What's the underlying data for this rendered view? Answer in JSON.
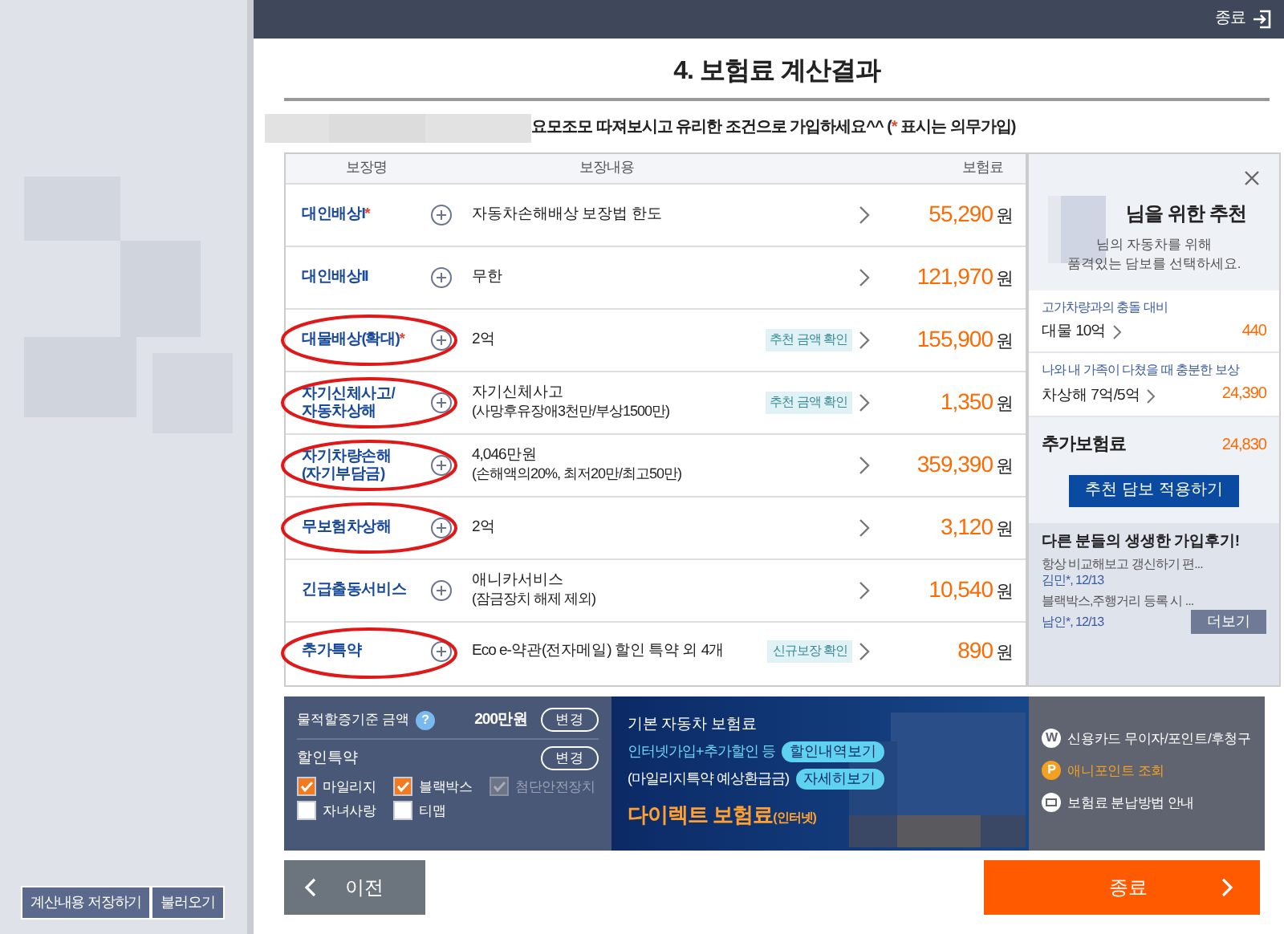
{
  "top_bar": {
    "close_label": "종료"
  },
  "left_panel": {
    "buttons": [
      "계산내용 저장하기",
      "불러오기"
    ]
  },
  "title": "4. 보험료 계산결과",
  "notice": {
    "text": "요모조모 따져보시고 유리한 조건으로 가입하세요^^ (",
    "mark": "*",
    "after": " 표시는 의무가입)"
  },
  "table": {
    "columns": [
      "보장명",
      "보장내용",
      "보험료"
    ],
    "rows": [
      {
        "name": "대인배상I",
        "required": true,
        "content": [
          "자동차손해배상 보장법 한도"
        ],
        "premium": "55,290",
        "unit": "원",
        "circled": false
      },
      {
        "name": "대인배상II",
        "required": false,
        "content": [
          "무한"
        ],
        "premium": "121,970",
        "unit": "원",
        "circled": false
      },
      {
        "name": "대물배상(확대)",
        "required": true,
        "content": [
          "2억"
        ],
        "badge": "추천 금액 확인",
        "premium": "155,900",
        "unit": "원",
        "circled": true
      },
      {
        "name": "자기신체사고/ 자동차상해",
        "required": false,
        "content": [
          "자기신체사고",
          "(사망후유장애3천만/부상1500만)"
        ],
        "badge": "추천 금액 확인",
        "premium": "1,350",
        "unit": "원",
        "circled": true
      },
      {
        "name": "자기차량손해 (자기부담금)",
        "required": false,
        "content": [
          "4,046만원",
          "(손해액의20%, 최저20만/최고50만)"
        ],
        "premium": "359,390",
        "unit": "원",
        "circled": true
      },
      {
        "name": "무보험차상해",
        "required": false,
        "content": [
          "2억"
        ],
        "premium": "3,120",
        "unit": "원",
        "circled": true
      },
      {
        "name": "긴급출동서비스",
        "required": false,
        "content": [
          "애니카서비스",
          "(잠금장치 해제 제외)"
        ],
        "premium": "10,540",
        "unit": "원",
        "circled": false
      },
      {
        "name": "추가특약",
        "required": false,
        "content": [
          "Eco e-약관(전자메일) 할인 특약 외 4개"
        ],
        "badge": "신규보장 확인",
        "premium": "890",
        "unit": "원",
        "circled": true
      }
    ]
  },
  "recommend": {
    "title": "님을 위한 추천",
    "subtitle": [
      "님의 자동차를 위해",
      "품격있는 담보를 선택하세요."
    ],
    "items": [
      {
        "desc": "고가차량과의 충돌 대비",
        "item": "대물 10억",
        "amount": "440"
      },
      {
        "desc": "나와 내 가족이 다쳤을 때 충분한 보상",
        "item": "차상해 7억/5억",
        "amount": "24,390"
      }
    ],
    "extra_label": "추가보험료",
    "extra_amount": "24,830",
    "apply_button": "추천 담보 적용하기",
    "reviews_title": "다른 분들의 생생한 가입후기!",
    "reviews": [
      {
        "text": "항상 비교해보고 갱신하기 편...",
        "author": "김민*, 12/13"
      },
      {
        "text": "블랙박스,주행거리 등록 시 ...",
        "author": "남인*, 12/13"
      }
    ],
    "more_button": "더보기"
  },
  "options": {
    "base_label": "물적할증기준 금액",
    "help": "?",
    "base_value": "200만원",
    "change_button": "변경",
    "discount_label": "할인특약",
    "discount_change": "변경",
    "checks": [
      {
        "label": "마일리지",
        "checked": true,
        "disabled": false
      },
      {
        "label": "블랙박스",
        "checked": true,
        "disabled": false
      },
      {
        "label": "첨단안전장치",
        "checked": true,
        "disabled": true
      },
      {
        "label": "자녀사랑",
        "checked": false,
        "disabled": false
      },
      {
        "label": "티맵",
        "checked": false,
        "disabled": false
      }
    ]
  },
  "premium_box": {
    "base_label": "기본 자동차 보험료",
    "discount_label": "인터넷가입+추가할인 등",
    "discount_button": "할인내역보기",
    "refund_label": "(마일리지특약 예상환급금)",
    "refund_button": "자세히보기",
    "direct_label": "다이렉트 보험료",
    "direct_suffix": "(인터넷)"
  },
  "links": [
    {
      "kind": "letter",
      "icon": "W",
      "text": "신용카드 무이자/포인트/후청구",
      "accent": false
    },
    {
      "kind": "letter",
      "icon": "P",
      "text": "애니포인트 조회",
      "accent": true
    },
    {
      "kind": "card",
      "text": "보험료 분납방법 안내",
      "accent": false
    }
  ],
  "nav": {
    "prev": "이전",
    "next": "종료"
  }
}
